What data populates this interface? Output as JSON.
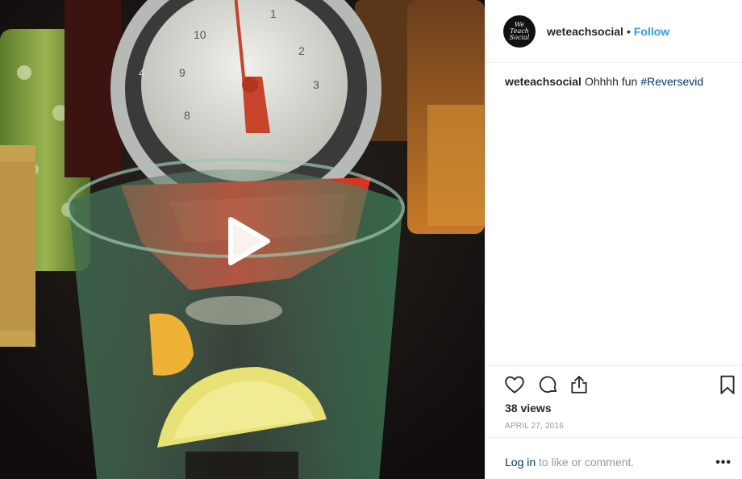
{
  "post": {
    "username": "weteachsocial",
    "separator": "•",
    "follow_label": "Follow",
    "avatar_text": "We Teach Social",
    "caption": {
      "username": "weteachsocial",
      "text": "Ohhhh fun",
      "hashtag": "#Reversevid"
    },
    "views": "38 views",
    "date": "APRIL 27, 2016",
    "login": {
      "link": "Log in",
      "rest": " to like or comment."
    },
    "more_label": "•••"
  },
  "media": {
    "type": "video",
    "description_icons": [
      "play-icon"
    ],
    "scale_dial_labels": [
      "10",
      "9",
      "8",
      "1",
      "2",
      "3",
      "4"
    ]
  },
  "icons": [
    "heart-icon",
    "comment-icon",
    "share-icon",
    "bookmark-icon",
    "play-icon"
  ],
  "colors": {
    "follow": "#3897f0",
    "hashtag": "#003569",
    "muted": "#999999",
    "text": "#262626",
    "divider": "#efefef"
  }
}
